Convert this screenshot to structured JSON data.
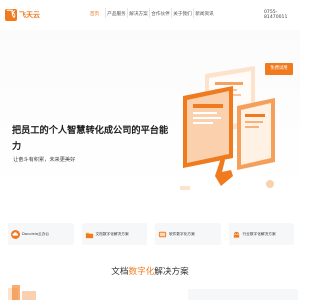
{
  "brand": {
    "name": "飞天云",
    "mark": "飞"
  },
  "nav": {
    "items": [
      {
        "label": "首页",
        "active": true
      },
      {
        "label": "产品服务",
        "active": false
      },
      {
        "label": "解决方案",
        "active": false
      },
      {
        "label": "合作伙伴",
        "active": false
      },
      {
        "label": "关于我们",
        "active": false
      },
      {
        "label": "新闻资讯",
        "active": false
      }
    ],
    "phone": "0755-81470011"
  },
  "hero": {
    "title": "把员工的个人智慧转化成公司的平台能力",
    "subtitle": "让奋斗有积累，未来更美好",
    "trial_button": "免费试用"
  },
  "features": [
    {
      "label": "Doculeia云办公",
      "icon": "cloud-office-icon"
    },
    {
      "label": "文档数字化解决方案",
      "icon": "folder-icon"
    },
    {
      "label": "软件数字化方案",
      "icon": "software-icon"
    },
    {
      "label": "行业数字化解决方案",
      "icon": "android-icon"
    }
  ],
  "section": {
    "title_prefix": "文档",
    "title_highlight": "数字化",
    "title_suffix": "解决方案"
  },
  "colors": {
    "accent": "#f07a1e",
    "bg": "#ffffff",
    "card": "#f6f7f9"
  }
}
